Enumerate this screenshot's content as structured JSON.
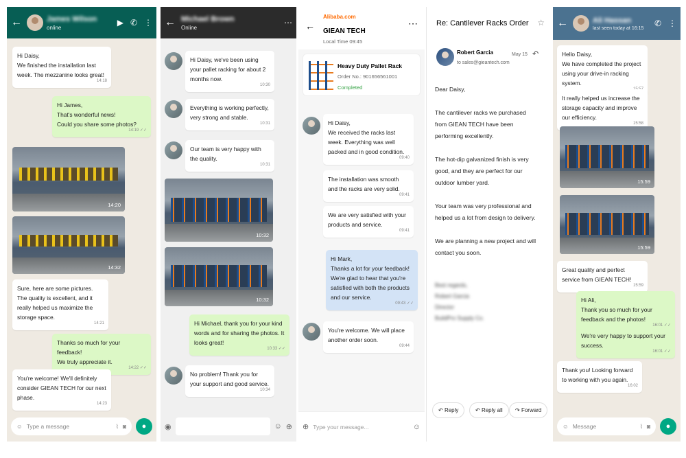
{
  "p1": {
    "name": "James Wilson",
    "status": "online",
    "msgs": [
      {
        "text": "Hi Daisy,\nWe finished the installation last week. The mezzanine looks great!",
        "time": "14:18"
      },
      {
        "text": "Hi James,\nThat's wonderful news!\nCould you share some photos?",
        "time": "14:19 ✓✓"
      },
      {
        "text": "Sure, here are some pictures. The quality is excellent, and it really helped us maximize the storage space.",
        "time": "14:21"
      },
      {
        "text": "Thanks so much for your feedback!\nWe truly appreciate it.",
        "time": "14:22 ✓✓"
      },
      {
        "text": "You're welcome! We'll definitely consider GIEAN TECH for our next phase.",
        "time": "14:23"
      }
    ],
    "img1_time": "14:20",
    "img2_time": "14:32",
    "placeholder": "Type a message"
  },
  "p2": {
    "name": "Michael Brown",
    "status": "Online",
    "msgs": [
      {
        "text": "Hi Daisy, we've been using your pallet racking for about 2 months now.",
        "time": "10:30"
      },
      {
        "text": "Everything is working perfectly, very strong and stable.",
        "time": "10:31"
      },
      {
        "text": "Our team is very happy with the quality.",
        "time": "10:31"
      },
      {
        "text": "Hi Michael, thank you for your kind words and for sharing the photos. It looks great!",
        "time": "10:33 ✓✓"
      },
      {
        "text": "No problem! Thank you for your support and good service.",
        "time": "10:34"
      }
    ],
    "img1_time": "10:32",
    "img2_time": "10:32"
  },
  "p3": {
    "logo": "Alibaba.com",
    "company": "GIEAN TECH",
    "local_time": "Local Time 09:45",
    "order_title": "Heavy Duty Pallet Rack",
    "order_no": "Order No.: 901656561001",
    "order_status": "Completed",
    "msgs": [
      {
        "text": "Hi Daisy,\nWe received the racks last week. Everything was well packed and in good condition.",
        "time": "09:40"
      },
      {
        "text": "The installation was smooth and the racks are very solid.",
        "time": "09:41"
      },
      {
        "text": "We are very satisfied with your products and service.",
        "time": "09:41"
      },
      {
        "text": "Hi Mark,\nThanks a lot for your feedback! We're glad to hear that you're satisfied with both the products and our service.",
        "time": "09:43 ✓✓"
      },
      {
        "text": "You're welcome. We will place another order soon.",
        "time": "09:44"
      }
    ],
    "placeholder": "Type your message..."
  },
  "p4": {
    "subject": "Re: Cantilever Racks Order",
    "sender": "Robert Garcia",
    "to": "to sales@gieantech.com",
    "date": "May 15",
    "body": [
      "Dear Daisy,",
      "The cantilever racks we purchased from GIEAN TECH have been performing excellently.",
      "The hot-dip galvanized finish is very good, and they are perfect for our outdoor lumber yard.",
      "Your team was very professional and helped us a lot from design to delivery.",
      "We are planning a new project and will contact you soon."
    ],
    "sig": [
      "Best regards,",
      "Robert Garcia",
      "Director",
      "BuildPro Supply Co."
    ],
    "reply": "Reply",
    "reply_all": "Reply all",
    "forward": "Forward"
  },
  "p5": {
    "name": "Ali Hassan",
    "status": "last seen today at 16:15",
    "msgs": [
      {
        "text": "Hello Daisy,\nWe have completed the project using your drive-in racking system.",
        "time": "15:57"
      },
      {
        "text": "It really helped us increase the storage capacity and improve our efficiency.",
        "time": "15:58"
      },
      {
        "text": "Great quality and perfect service from GIEAN TECH!",
        "time": "15:59"
      },
      {
        "text": "Hi Ali,\nThank you so much for your feedback and the photos!",
        "time": "16:01 ✓✓"
      },
      {
        "text": "We're very happy to support your success.",
        "time": "16:01 ✓✓"
      },
      {
        "text": "Thank you! Looking forward to working with you again.",
        "time": "16:02"
      }
    ],
    "img1_time": "15:59",
    "img2_time": "15:59",
    "placeholder": "Message"
  }
}
